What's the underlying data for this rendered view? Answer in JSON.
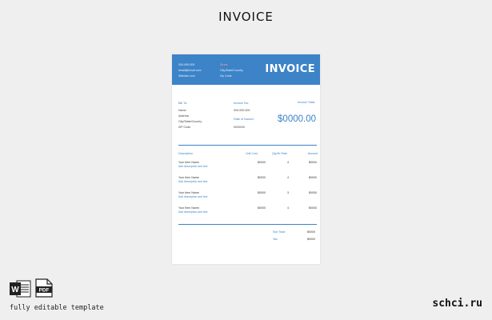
{
  "heading": "INVOICE",
  "invoice": {
    "title": "INVOICE",
    "company": [
      "000-000-000",
      "email@email.com",
      "Website.com"
    ],
    "address": [
      "Street",
      "City,State/Country",
      "Zip Code"
    ],
    "bill_to": {
      "label": "Bill To:",
      "lines": [
        "Name",
        "Address",
        "City/State/Country",
        "ZIP Code"
      ]
    },
    "invoice_no": {
      "label": "Invoice No:",
      "value": "000-000-000"
    },
    "date_issued": {
      "label": "Date of Issued:",
      "value": "00/00/00"
    },
    "invoice_total": {
      "label": "Invoice Total:",
      "value": "$0000.00"
    },
    "columns": [
      "Description",
      "Unit Cost",
      "Qty/Hr Rate",
      "Amount"
    ],
    "items": [
      {
        "name": "Your Item Name",
        "desc": "Add description and text",
        "unit": "$0000",
        "qty": "4",
        "amount": "$0000"
      },
      {
        "name": "Your Item Name",
        "desc": "Add description and text",
        "unit": "$0000",
        "qty": "4",
        "amount": "$0000"
      },
      {
        "name": "Your Item Name",
        "desc": "Add description and text",
        "unit": "$0000",
        "qty": "3",
        "amount": "$0000"
      },
      {
        "name": "Your Item Name",
        "desc": "Add description and text",
        "unit": "$0000",
        "qty": "4",
        "amount": "$0000"
      }
    ],
    "subtotal": {
      "label": "Sub Total:",
      "value": "$0000"
    },
    "tax": {
      "label": "Tax:",
      "value": "$0000"
    }
  },
  "footer": {
    "word_letter": "W",
    "pdf_label": "PDF",
    "caption": "fully editable template",
    "brand": "schci.ru"
  },
  "colors": {
    "accent": "#3c83c8",
    "background": "#efefef"
  }
}
